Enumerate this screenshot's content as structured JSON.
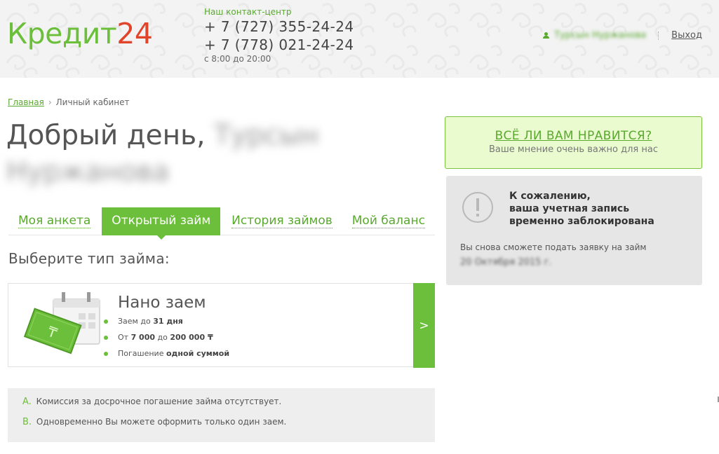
{
  "header": {
    "logo_part1": "Кредит",
    "logo_part2": "24",
    "contact_label": "Наш контакт-центр",
    "phone1": "+ 7 (727) 355-24-24",
    "phone2": "+ 7 (778) 021-24-24",
    "hours": "с 8:00 до 20:00",
    "username": "Турсын Нуржанова",
    "logout": "Выход"
  },
  "breadcrumb": {
    "home": "Главная",
    "separator": "›",
    "current": "Личный кабинет"
  },
  "greeting": {
    "prefix": "Добрый день,",
    "name_first": "Турсын",
    "name_last": "Нуржанова"
  },
  "tabs": [
    {
      "label": "Моя анкета",
      "active": false
    },
    {
      "label": "Открытый займ",
      "active": true
    },
    {
      "label": "История займов",
      "active": false
    },
    {
      "label": "Мой баланс",
      "active": false
    }
  ],
  "choose_title": "Выберите тип займа:",
  "loan": {
    "title": "Нано заем",
    "term_prefix": "Заем до ",
    "term_value": "31 дня",
    "amount_prefix": "От ",
    "amount_from": "7 000",
    "amount_mid": " до ",
    "amount_to": "200 000 ₸",
    "repay_prefix": "Погашение ",
    "repay_value": "одной суммой",
    "arrow": ">",
    "currency_symbol": "₸"
  },
  "notes": [
    {
      "letter": "A.",
      "text": "Комиссия за досрочное погашение займа отсутствует."
    },
    {
      "letter": "B.",
      "text": "Одновременно Вы можете оформить только один заем."
    }
  ],
  "feedback": {
    "title": "ВСЁ ЛИ ВАМ НРАВИТСЯ?",
    "subtitle": "Ваше мнение очень важно для нас"
  },
  "blocked": {
    "line1": "К сожалению,",
    "line2": "ваша учетная запись",
    "line3": "временно заблокирована",
    "info": "Вы снова сможете подать заявку на займ",
    "date": "20 Октября 2015 г."
  },
  "colors": {
    "accent": "#6cbf3a",
    "logo_red": "#e0452b",
    "feedback_bg": "#eafbd0",
    "blocked_bg": "#e6e6e6"
  },
  "icons": [
    "user-icon",
    "warning-icon",
    "calendar-icon",
    "banknote-icon",
    "chevron-right-icon"
  ]
}
